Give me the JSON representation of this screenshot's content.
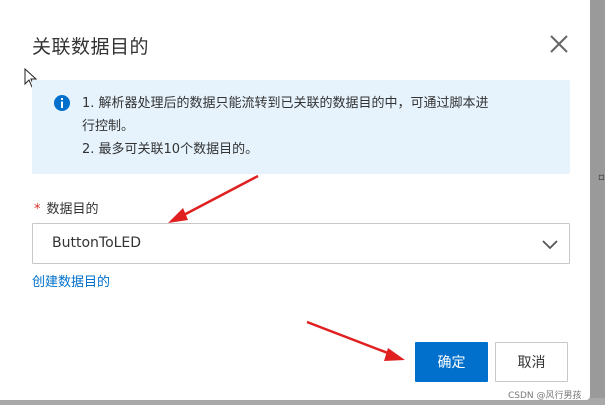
{
  "dialog": {
    "title": "关联数据目的",
    "close_icon": "close-icon"
  },
  "notice": {
    "icon": "info-icon",
    "line1": "1. 解析器处理后的数据只能流转到已关联的数据目的中，可通过脚本进",
    "line1b": "行控制。",
    "line2": "2. 最多可关联10个数据目的。",
    "background": "#e6f3fd",
    "icon_color": "#0070cc"
  },
  "form": {
    "required_mark": "*",
    "label": "数据目的",
    "select_value": "ButtonToLED",
    "chevron_icon": "chevron-down-icon",
    "create_link": "创建数据目的"
  },
  "footer": {
    "ok_label": "确定",
    "cancel_label": "取消"
  },
  "watermark": "CSDN @风行男孩",
  "colors": {
    "primary": "#0070cc",
    "required": "#d93026",
    "annotation_arrow": "#e02020"
  }
}
